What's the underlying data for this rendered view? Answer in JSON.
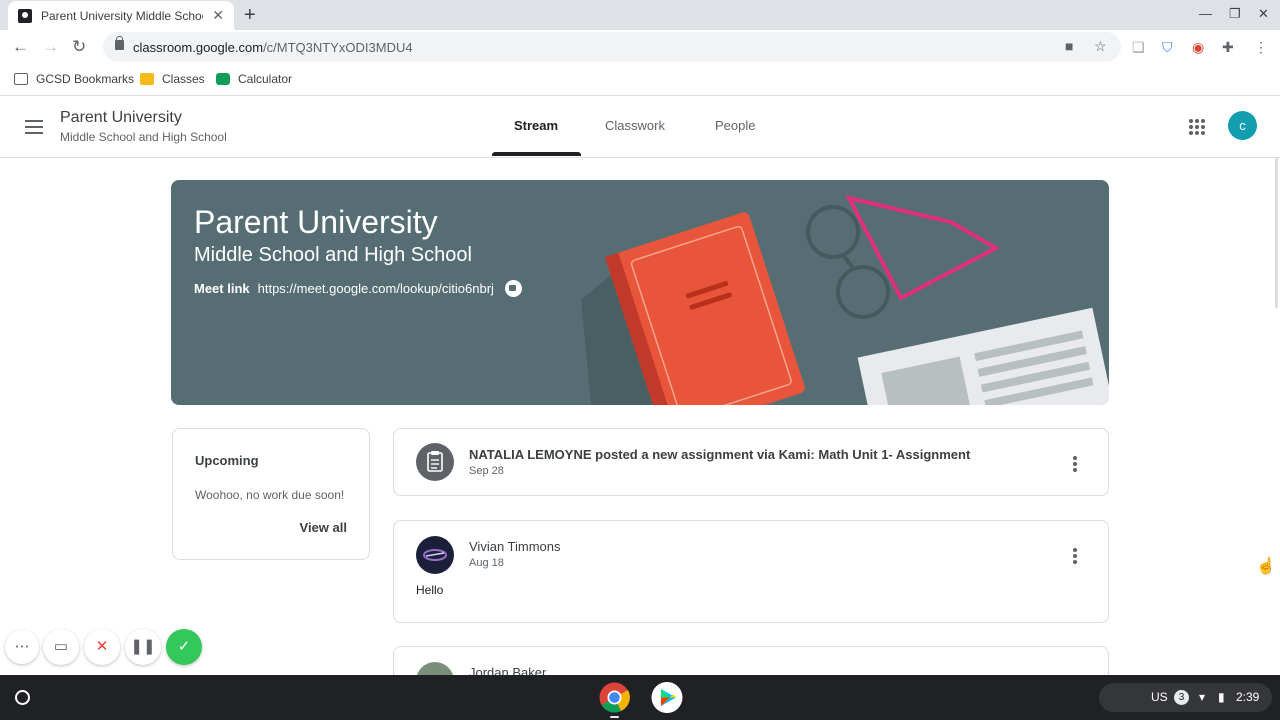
{
  "browser": {
    "tab_title": "Parent University Middle School",
    "tab_close": "✕",
    "new_tab": "+",
    "url_domain": "classroom.google.com",
    "url_path": "/c/MTQ3NTYxODI3MDU4",
    "bookmarks": [
      "GCSD Bookmarks",
      "Classes",
      "Calculator"
    ]
  },
  "header": {
    "class_title": "Parent University",
    "class_subtitle": "Middle School and High School",
    "tabs": [
      "Stream",
      "Classwork",
      "People"
    ],
    "active_tab": "Stream",
    "avatar_letter": "c"
  },
  "banner": {
    "title": "Parent University",
    "subtitle": "Middle School and High School",
    "meet_label": "Meet link",
    "meet_url": "https://meet.google.com/lookup/citio6nbrj"
  },
  "upcoming": {
    "title": "Upcoming",
    "message": "Woohoo, no work due soon!",
    "view_all": "View all"
  },
  "posts": [
    {
      "title": "NATALIA LEMOYNE posted a new assignment via Kami: Math Unit 1- Assignment",
      "date": "Sep 28",
      "icon": "assignment-icon"
    },
    {
      "author": "Vivian Timmons",
      "date": "Aug 18",
      "body": "Hello"
    },
    {
      "author": "Jordan Baker"
    }
  ],
  "shelf": {
    "locale": "US",
    "notifications": "3",
    "time": "2:39"
  },
  "colors": {
    "banner": "#566e73",
    "avatar": "#129eaf",
    "book": "#e8553a",
    "glasses_pink": "#e0307a"
  }
}
